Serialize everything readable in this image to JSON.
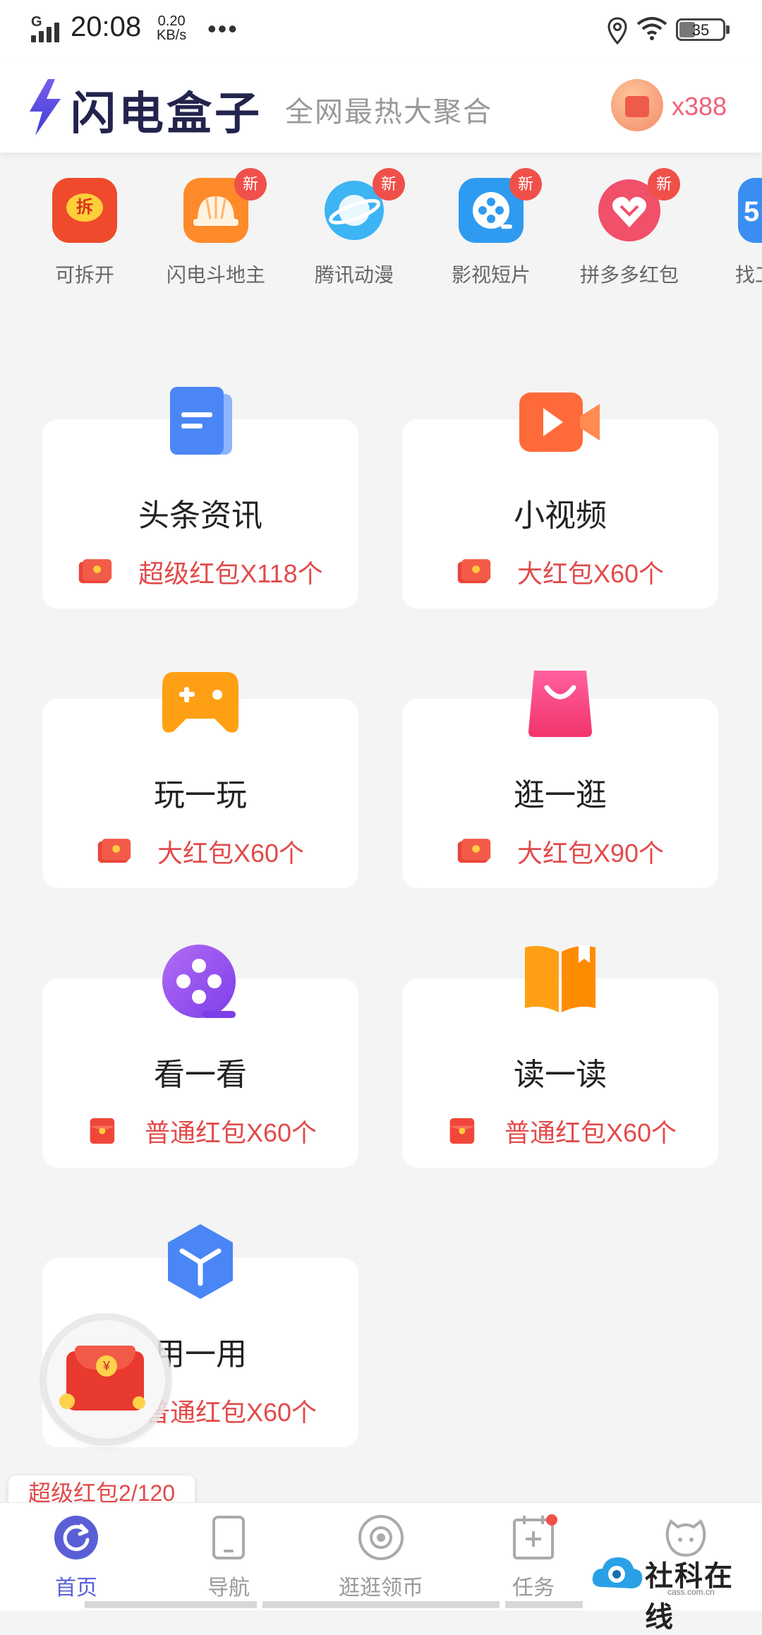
{
  "status_bar": {
    "network": "G",
    "time": "20:08",
    "speed_value": "0.20",
    "speed_unit": "KB/s",
    "more": "•••",
    "battery": "35"
  },
  "header": {
    "app_name": "闪电盒子",
    "slogan": "全网最热大聚合",
    "coin_count": "x388"
  },
  "shortcuts": [
    {
      "label": "可拆开",
      "icon": "red-packet-open-icon",
      "badge": "",
      "color": "#ef4a2c",
      "glyph": "拆"
    },
    {
      "label": "闪电斗地主",
      "icon": "landlord-hat-icon",
      "badge": "新",
      "color": "#ff8a2a",
      "glyph": ""
    },
    {
      "label": "腾讯动漫",
      "icon": "planet-icon",
      "badge": "新",
      "color": "#3db4f4",
      "glyph": ""
    },
    {
      "label": "影视短片",
      "icon": "film-reel-icon",
      "badge": "新",
      "color": "#2f9bf0",
      "glyph": ""
    },
    {
      "label": "拼多多红包",
      "icon": "pinduoduo-icon",
      "badge": "新",
      "color": "#f0506a",
      "glyph": ""
    },
    {
      "label": "找工",
      "icon": "job-icon",
      "badge": "",
      "color": "#3a8ef2",
      "glyph": "5"
    }
  ],
  "cards": [
    {
      "title": "头条资讯",
      "reward": "超级红包X118个",
      "icon": "news-document-icon"
    },
    {
      "title": "小视频",
      "reward": "大红包X60个",
      "icon": "video-camera-icon"
    },
    {
      "title": "玩一玩",
      "reward": "大红包X60个",
      "icon": "gamepad-icon"
    },
    {
      "title": "逛一逛",
      "reward": "大红包X90个",
      "icon": "shopping-bag-icon"
    },
    {
      "title": "看一看",
      "reward": "普通红包X60个",
      "icon": "film-reel-icon"
    },
    {
      "title": "读一读",
      "reward": "普通红包X60个",
      "icon": "book-icon"
    },
    {
      "title": "用一用",
      "reward": "普通红包X60个",
      "icon": "cube-icon"
    }
  ],
  "floating_packet": {
    "symbol": "¥"
  },
  "promo_badge": "超级红包2/120",
  "bottom_nav": [
    {
      "label": "首页",
      "icon": "refresh-icon",
      "active": true
    },
    {
      "label": "导航",
      "icon": "tablet-icon",
      "active": false
    },
    {
      "label": "逛逛领币",
      "icon": "eye-icon",
      "active": false
    },
    {
      "label": "任务",
      "icon": "calendar-plus-icon",
      "active": false
    },
    {
      "label": "",
      "icon": "chat-face-icon",
      "active": false
    }
  ],
  "watermark": {
    "text": "社科在线",
    "sub": "cass.com.cn"
  }
}
